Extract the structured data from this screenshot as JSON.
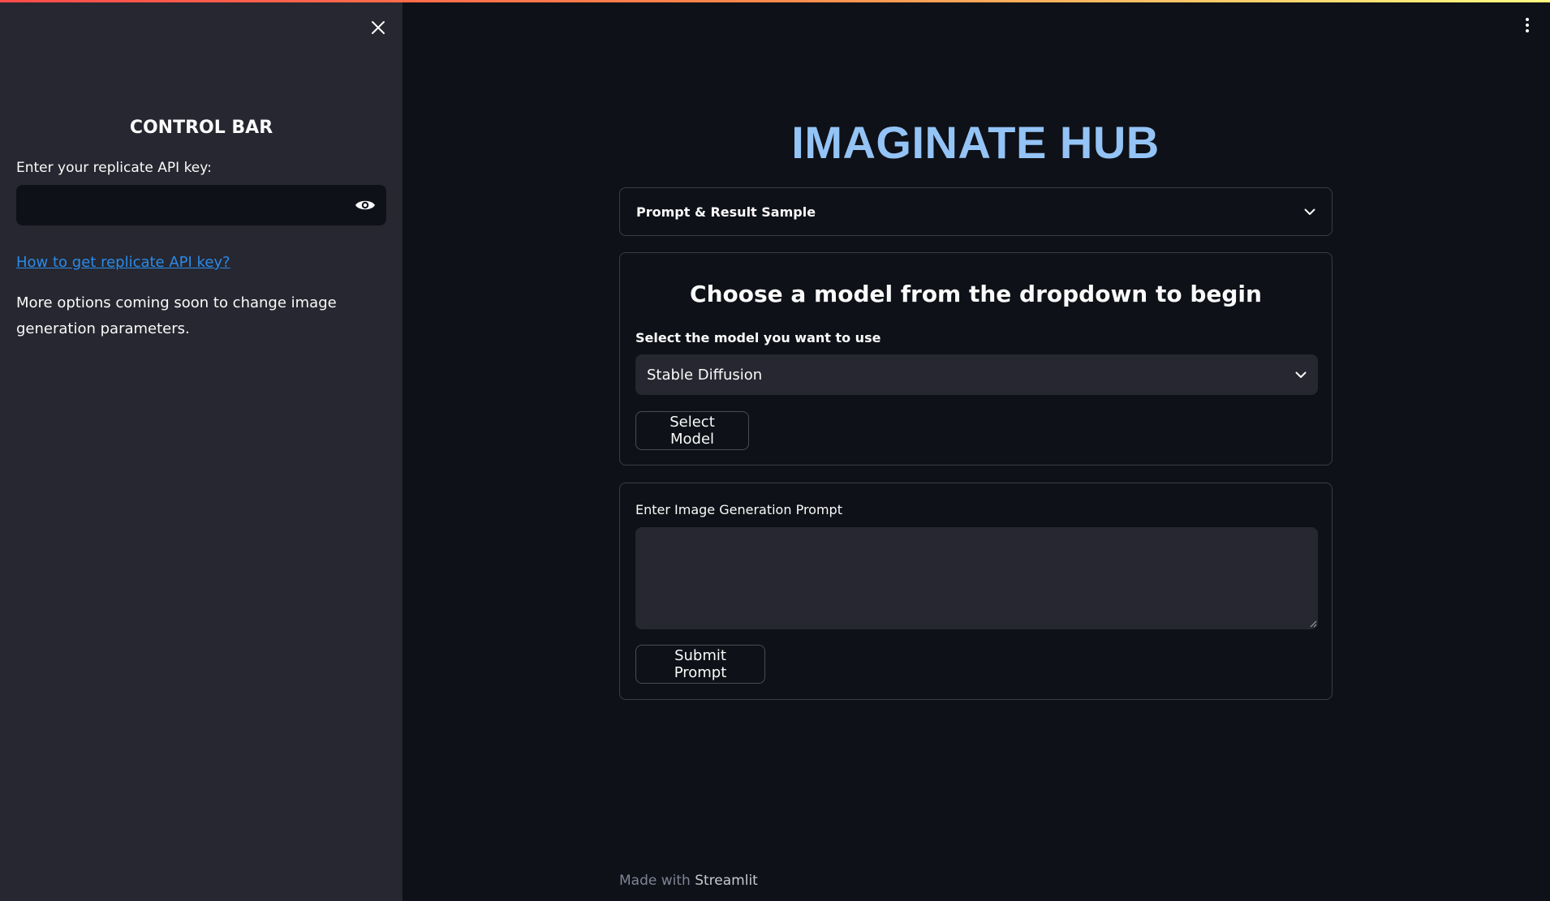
{
  "sidebar": {
    "title": "CONTROL BAR",
    "api_key_label": "Enter your replicate API key:",
    "api_key_value": "",
    "help_link": "How to get replicate API key?",
    "note": "More options coming soon to change image generation parameters."
  },
  "main": {
    "title": "IMAGINATE HUB",
    "expander_label": "Prompt & Result Sample",
    "model_card": {
      "heading": "Choose a model from the dropdown to begin",
      "select_label": "Select the model you want to use",
      "selected_model": "Stable Diffusion",
      "button_label": "Select Model"
    },
    "prompt_card": {
      "label": "Enter Image Generation Prompt",
      "prompt_value": "",
      "button_label": "Submit Prompt"
    }
  },
  "footer": {
    "prefix": "Made with",
    "brand": "Streamlit"
  },
  "icons": {
    "close": "close-icon",
    "eye": "eye-icon",
    "chevron": "chevron-down-icon",
    "menu": "more-vertical-icon"
  },
  "colors": {
    "background": "#0e1117",
    "sidebar": "#262730",
    "title": "#94c3f6",
    "link": "#2b8be8",
    "accent_gradient": [
      "#ff4b4b",
      "#fffd80"
    ]
  }
}
